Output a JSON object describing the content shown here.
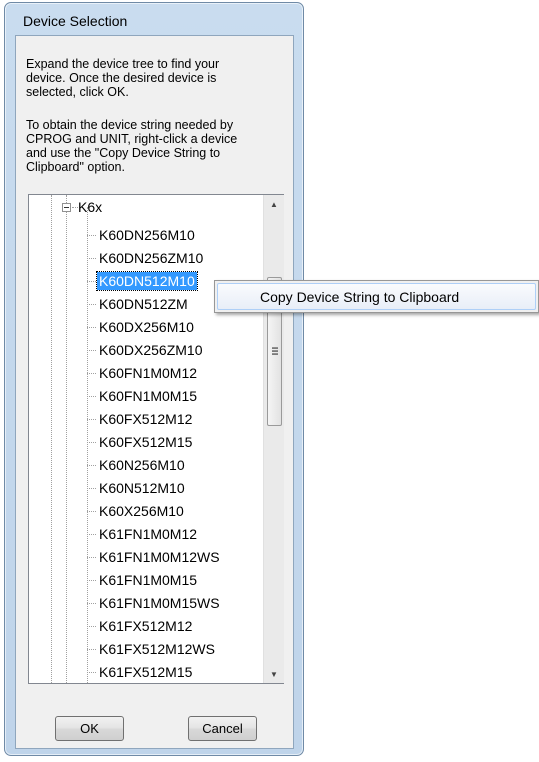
{
  "window": {
    "title": "Device Selection"
  },
  "instructions": {
    "paragraph1_lines": [
      "Expand the device tree to find your",
      "device. Once the desired device is",
      "selected, click OK."
    ],
    "paragraph2_lines": [
      "To obtain the device string needed by",
      "CPROG and UNIT, right-click a device",
      "and use the \"Copy Device String to",
      "Clipboard\" option."
    ]
  },
  "tree": {
    "parent_label": "K6x",
    "selected_index": 2,
    "items": [
      "K60DN256M10",
      "K60DN256ZM10",
      "K60DN512M10",
      "K60DN512ZM",
      "K60DX256M10",
      "K60DX256ZM10",
      "K60FN1M0M12",
      "K60FN1M0M15",
      "K60FX512M12",
      "K60FX512M15",
      "K60N256M10",
      "K60N512M10",
      "K60X256M10",
      "K61FN1M0M12",
      "K61FN1M0M12WS",
      "K61FN1M0M15",
      "K61FN1M0M15WS",
      "K61FX512M12",
      "K61FX512M12WS",
      "K61FX512M15"
    ]
  },
  "buttons": {
    "ok": "OK",
    "cancel": "Cancel"
  },
  "context_menu": {
    "items": [
      "Copy Device String to Clipboard"
    ]
  },
  "icons": {
    "expander": "tree-collapse-icon",
    "scroll_up": "scroll-up-arrow-icon",
    "scroll_down": "scroll-down-arrow-icon"
  }
}
